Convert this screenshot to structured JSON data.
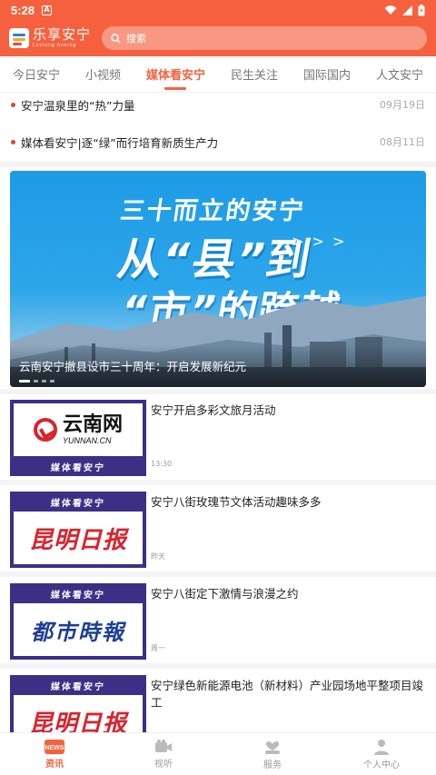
{
  "status_bar": {
    "time": "5:28",
    "notice_letter": "A"
  },
  "header": {
    "logo_cn": "乐享安宁",
    "logo_en": "Lexiang Anning",
    "search_placeholder": "搜索"
  },
  "tabs": [
    {
      "label": "今日安宁",
      "active": false
    },
    {
      "label": "小视频",
      "active": false
    },
    {
      "label": "媒体看安宁",
      "active": true
    },
    {
      "label": "民生关注",
      "active": false
    },
    {
      "label": "国际国内",
      "active": false
    },
    {
      "label": "人文安宁",
      "active": false
    }
  ],
  "top_news": [
    {
      "title": "安宁温泉里的“热”力量",
      "date": "09月19日"
    },
    {
      "title": "媒体看安宁|逐“绿”而行培育新质生产力",
      "date": "08月11日"
    }
  ],
  "banner": {
    "headline_line1": "三十而立的安宁",
    "headline_line2": "从“县”到",
    "headline_line3": "“市”的跨越",
    "arrows": "> > >",
    "caption": "云南安宁撤县设市三十周年：开启发展新纪元",
    "slide_count": 4,
    "active_slide": 1
  },
  "articles": [
    {
      "title": "安宁开启多彩文旅月活动",
      "time": "13:30",
      "source_logo": "云南网",
      "source_logo_en": "YUNNAN.CN",
      "strip_text": "媒体看安宁"
    },
    {
      "title": "安宁八街玫瑰节文体活动趣味多多",
      "time": "昨天",
      "source_logo": "昆明日报",
      "strip_text": "媒体看安宁"
    },
    {
      "title": "安宁八街定下激情与浪漫之约",
      "time": "周一",
      "source_logo": "都市時報",
      "strip_text": "媒体看安宁"
    },
    {
      "title": "安宁绿色新能源电池（新材料）产业园场地平整项目竣工",
      "time": "",
      "source_logo": "昆明日报",
      "strip_text": "媒体看安宁"
    }
  ],
  "bottom_nav": [
    {
      "label": "资讯",
      "icon": "news-icon",
      "active": true,
      "badge": "NEWS"
    },
    {
      "label": "视听",
      "icon": "video-icon",
      "active": false
    },
    {
      "label": "服务",
      "icon": "service-icon",
      "active": false
    },
    {
      "label": "个人中心",
      "icon": "person-icon",
      "active": false
    }
  ],
  "colors": {
    "brand": "#f5613f",
    "thumb_frame": "#3e2f86"
  }
}
